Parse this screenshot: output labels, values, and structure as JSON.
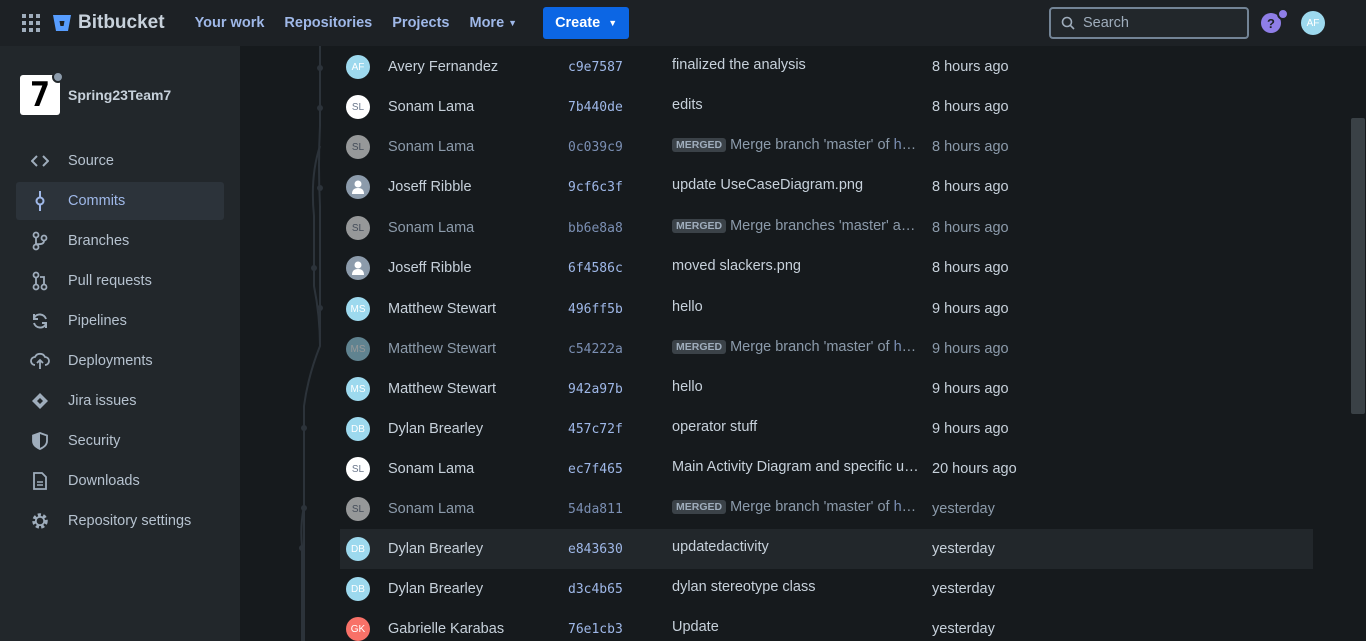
{
  "nav": {
    "product": "Bitbucket",
    "links": [
      "Your work",
      "Repositories",
      "Projects",
      "More"
    ],
    "create": "Create",
    "search_placeholder": "Search",
    "help": "?",
    "user_initials": "AF"
  },
  "repo": {
    "name": "Spring23Team7",
    "avatar_glyph": "7"
  },
  "sidebar": [
    {
      "label": "Source",
      "icon": "code-icon"
    },
    {
      "label": "Commits",
      "icon": "commit-icon",
      "active": true
    },
    {
      "label": "Branches",
      "icon": "branch-icon"
    },
    {
      "label": "Pull requests",
      "icon": "pull-request-icon"
    },
    {
      "label": "Pipelines",
      "icon": "pipelines-icon"
    },
    {
      "label": "Deployments",
      "icon": "deployments-icon"
    },
    {
      "label": "Jira issues",
      "icon": "jira-icon"
    },
    {
      "label": "Security",
      "icon": "shield-icon"
    },
    {
      "label": "Downloads",
      "icon": "file-icon"
    },
    {
      "label": "Repository settings",
      "icon": "gear-icon"
    }
  ],
  "commits": [
    {
      "initials": "AF",
      "author": "Avery Fernandez",
      "hash": "c9e7587",
      "message": "finalized the analysis",
      "time": "8 hours ago",
      "kind": "ap"
    },
    {
      "initials": "SL",
      "author": "Sonam Lama",
      "hash": "7b440de",
      "message": "edits",
      "time": "8 hours ago",
      "kind": "sl"
    },
    {
      "initials": "SL",
      "author": "Sonam Lama",
      "hash": "0c039c9",
      "badge": "MERGED",
      "message": "Merge branch 'master' of ",
      "link": "https://bitbucket.org",
      "time": "8 hours ago",
      "kind": "sl",
      "dim": true
    },
    {
      "initials": "",
      "author": "Joseff Ribble",
      "hash": "9cf6c3f",
      "message": "update UseCaseDiagram.png",
      "time": "8 hours ago",
      "kind": "jr"
    },
    {
      "initials": "SL",
      "author": "Sonam Lama",
      "hash": "bb6e8a8",
      "badge": "MERGED",
      "message": "Merge branches 'master' and 'master'",
      "time": "8 hours ago",
      "kind": "sl",
      "dim": true
    },
    {
      "initials": "",
      "author": "Joseff Ribble",
      "hash": "6f4586c",
      "message": "moved slackers.png",
      "time": "8 hours ago",
      "kind": "jr"
    },
    {
      "initials": "MS",
      "author": "Matthew Stewart",
      "hash": "496ff5b",
      "message": "hello",
      "time": "9 hours ago",
      "kind": "ms"
    },
    {
      "initials": "MS",
      "author": "Matthew Stewart",
      "hash": "c54222a",
      "badge": "MERGED",
      "message": "Merge branch 'master' of ",
      "link": "https://bitbucket.org",
      "time": "9 hours ago",
      "kind": "ms",
      "dim": true
    },
    {
      "initials": "MS",
      "author": "Matthew Stewart",
      "hash": "942a97b",
      "message": "hello",
      "time": "9 hours ago",
      "kind": "ms"
    },
    {
      "initials": "DB",
      "author": "Dylan Brearley",
      "hash": "457c72f",
      "message": "operator stuff",
      "time": "9 hours ago",
      "kind": "db"
    },
    {
      "initials": "SL",
      "author": "Sonam Lama",
      "hash": "ec7f465",
      "message": "Main Activity Diagram and specific use cases",
      "time": "20 hours ago",
      "kind": "sl"
    },
    {
      "initials": "SL",
      "author": "Sonam Lama",
      "hash": "54da811",
      "badge": "MERGED",
      "message": "Merge branch 'master' of ",
      "link": "https://bitbucket.org",
      "time": "yesterday",
      "kind": "sl",
      "dim": true
    },
    {
      "initials": "DB",
      "author": "Dylan Brearley",
      "hash": "e843630",
      "message": "updatedactivity",
      "time": "yesterday",
      "kind": "db",
      "highlight": true
    },
    {
      "initials": "DB",
      "author": "Dylan Brearley",
      "hash": "d3c4b65",
      "message": "dylan stereotype class",
      "time": "yesterday",
      "kind": "db"
    },
    {
      "initials": "GK",
      "author": "Gabrielle Karabas",
      "hash": "76e1cb3",
      "message": "Update",
      "time": "yesterday",
      "kind": "gk"
    }
  ]
}
